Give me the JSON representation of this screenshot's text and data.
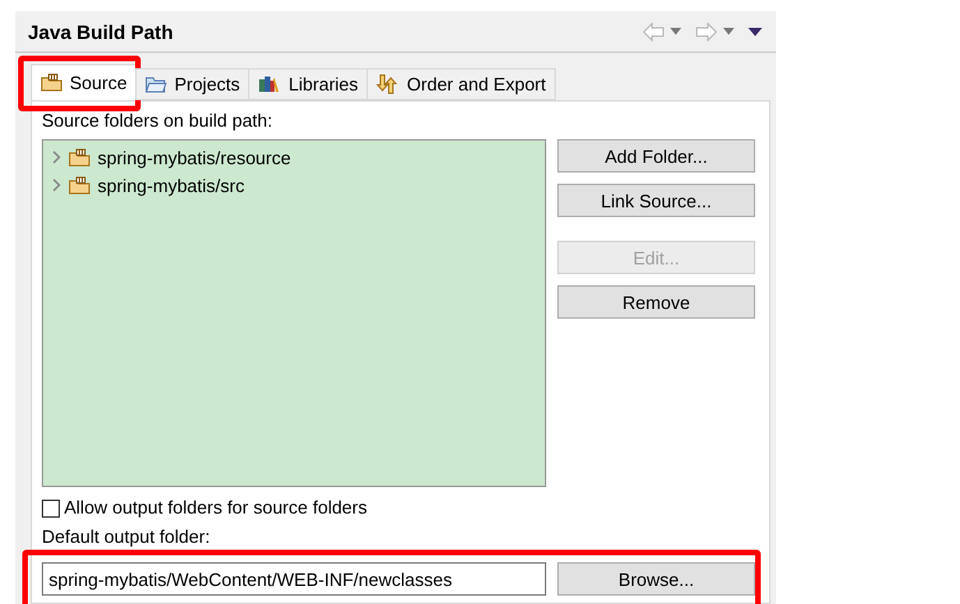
{
  "header": {
    "title": "Java Build Path"
  },
  "tabs": [
    {
      "label": "Source",
      "kind": "source",
      "selected": true,
      "highlighted": true
    },
    {
      "label": "Projects",
      "kind": "projects",
      "selected": false,
      "highlighted": false
    },
    {
      "label": "Libraries",
      "kind": "libraries",
      "selected": false,
      "highlighted": false
    },
    {
      "label": "Order and Export",
      "kind": "order",
      "selected": false,
      "highlighted": false
    }
  ],
  "source_panel": {
    "label": "Source folders on build path:",
    "tree": [
      {
        "label": "spring-mybatis/resource",
        "expanded": false
      },
      {
        "label": "spring-mybatis/src",
        "expanded": false
      }
    ],
    "buttons": [
      {
        "label": "Add Folder...",
        "disabled": false
      },
      {
        "label": "Link Source...",
        "disabled": false
      },
      {
        "label": "Edit...",
        "disabled": true
      },
      {
        "label": "Remove",
        "disabled": false
      }
    ],
    "allow_output": {
      "label": "Allow output folders for source folders",
      "checked": false
    },
    "output_label": "Default output folder:",
    "output": {
      "value": "spring-mybatis/WebContent/WEB-INF/newclasses",
      "button": "Browse...",
      "highlighted": true
    }
  }
}
